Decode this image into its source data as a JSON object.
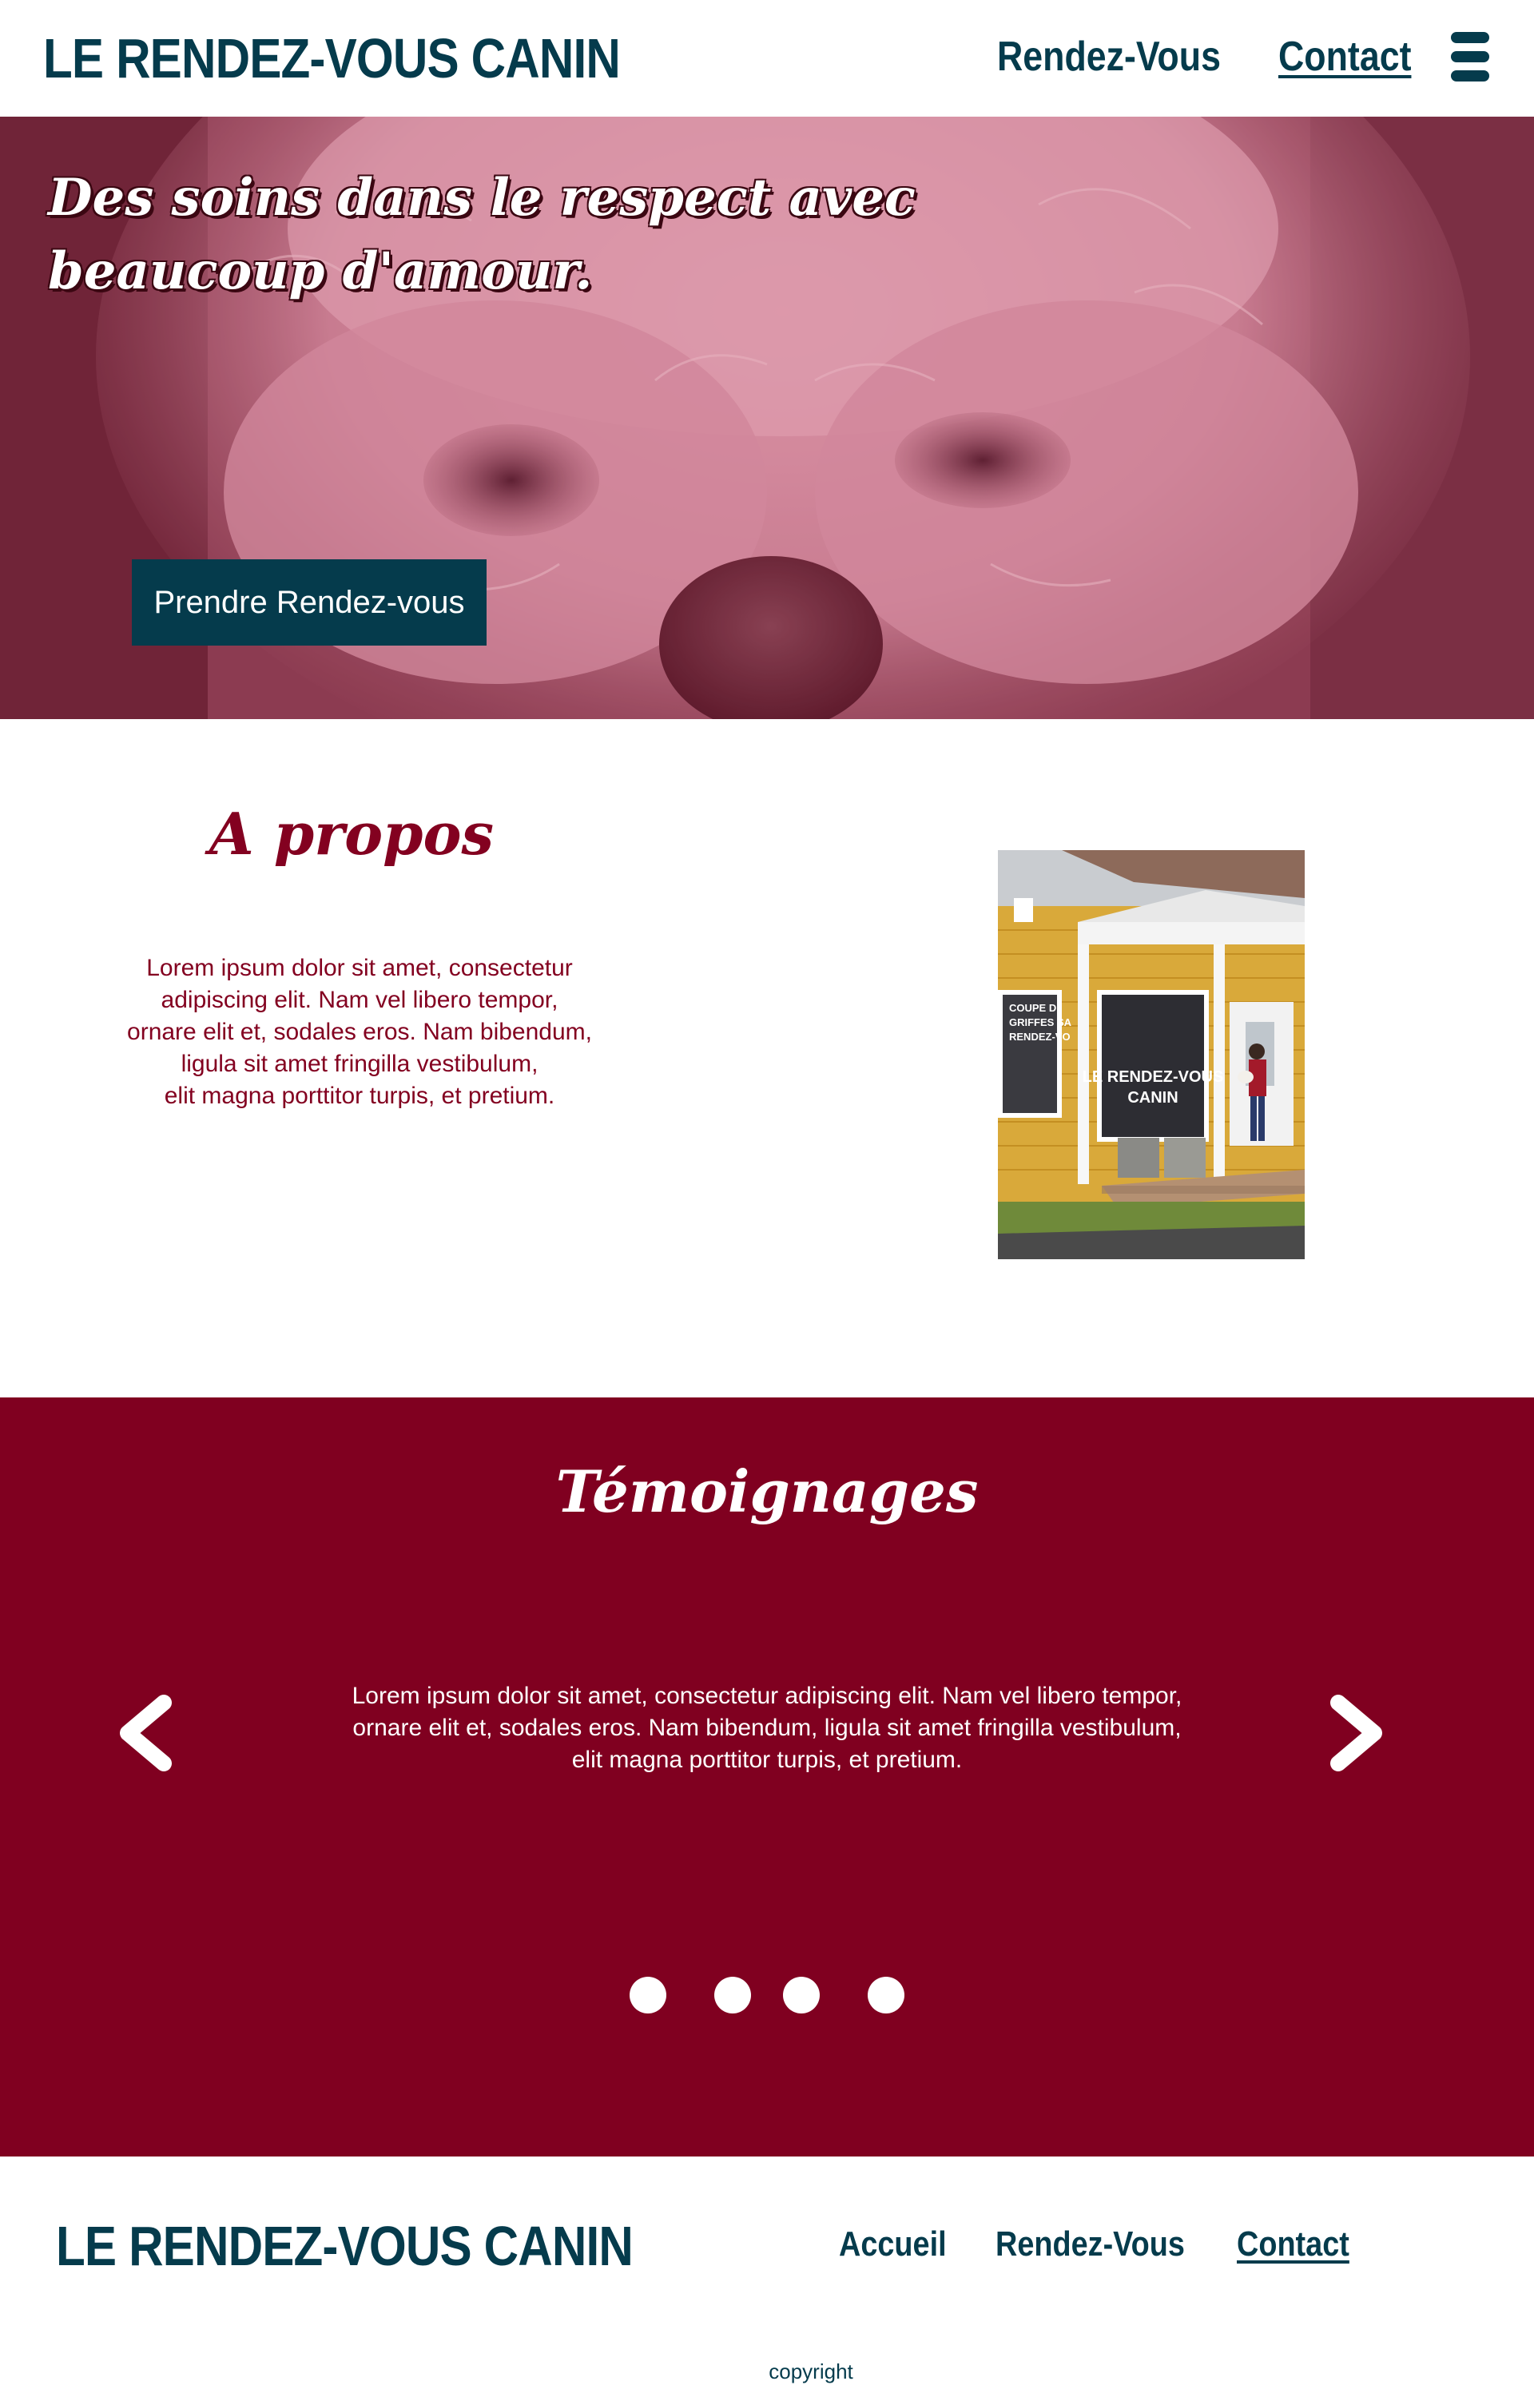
{
  "header": {
    "brand": "LE RENDEZ-VOUS CANIN",
    "nav": [
      {
        "label": "Rendez-Vous"
      },
      {
        "label": "Contact"
      }
    ],
    "menu_icon": "hamburger-menu-icon"
  },
  "hero": {
    "title_line1": "Des soins dans le respect avec",
    "title_line2": "beaucoup d'amour.",
    "button_label": "Prendre Rendez-vous"
  },
  "about": {
    "title": "A propos",
    "text_lines": [
      "Lorem ipsum dolor sit amet, consectetur",
      "adipiscing elit. Nam vel libero tempor,",
      "ornare elit et, sodales eros. Nam bibendum,",
      "ligula sit amet fringilla vestibulum,",
      "elit magna porttitor turpis, et pretium."
    ],
    "photo": {
      "sign_main_1": "LE RENDEZ-VOUS",
      "sign_main_2": "CANIN",
      "sign_side_1": "COUPE D",
      "sign_side_2": "GRIFFES SA",
      "sign_side_3": "RENDEZ-VO"
    }
  },
  "testimonials": {
    "title": "Témoignages",
    "text_lines": [
      "Lorem ipsum dolor sit amet, consectetur adipiscing elit. Nam vel libero tempor,",
      "ornare elit et, sodales eros. Nam bibendum, ligula sit amet fringilla vestibulum,",
      "elit magna porttitor turpis, et pretium."
    ],
    "prev_icon": "chevron-left-icon",
    "next_icon": "chevron-right-icon",
    "dots_count": 4
  },
  "footer": {
    "brand": "LE RENDEZ-VOUS CANIN",
    "links": [
      {
        "label": "Accueil"
      },
      {
        "label": "Rendez-Vous"
      },
      {
        "label": "Contact"
      }
    ],
    "copyright": "copyright"
  },
  "colors": {
    "navy": "#053b4c",
    "burgundy": "#800020",
    "white": "#ffffff"
  }
}
